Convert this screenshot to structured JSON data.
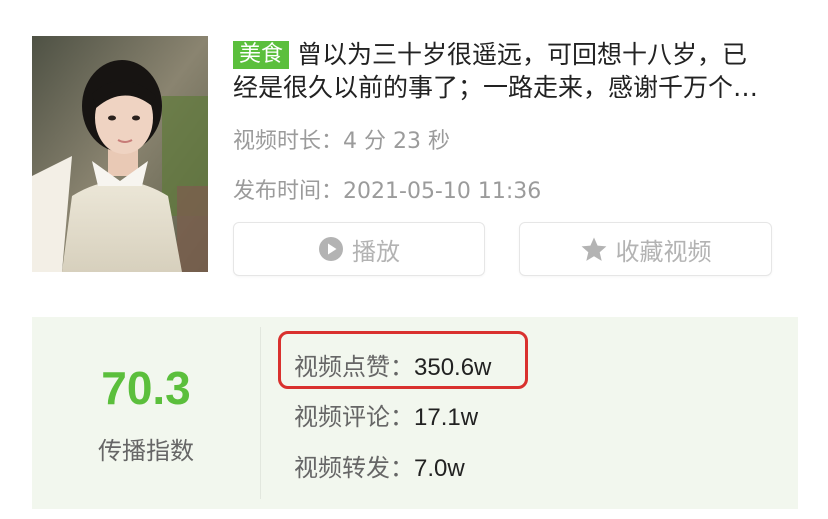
{
  "video": {
    "category": "美食",
    "title_line1": "曾以为三十岁很遥远，可回想十八岁，已",
    "title_line2": "经是很久以前的事了；一路走来，感谢千万个…",
    "duration_label": "视频时长：",
    "duration_value": "4 分 23 秒",
    "publish_label": "发布时间：",
    "publish_value": "2021-05-10 11:36"
  },
  "buttons": {
    "play_label": "播放",
    "favorite_label": "收藏视频"
  },
  "stats": {
    "index_value": "70.3",
    "index_label": "传播指数",
    "likes_label": "视频点赞：",
    "likes_value": "350.6w",
    "comments_label": "视频评论：",
    "comments_value": "17.1w",
    "shares_label": "视频转发：",
    "shares_value": "7.0w"
  },
  "icons": {
    "play": "play-circle-icon",
    "favorite": "star-icon"
  },
  "colors": {
    "accent_green": "#5bbf3c",
    "highlight_red": "#d9312e",
    "panel_bg": "#f2f7ee",
    "muted_text": "#9b9b9b"
  }
}
